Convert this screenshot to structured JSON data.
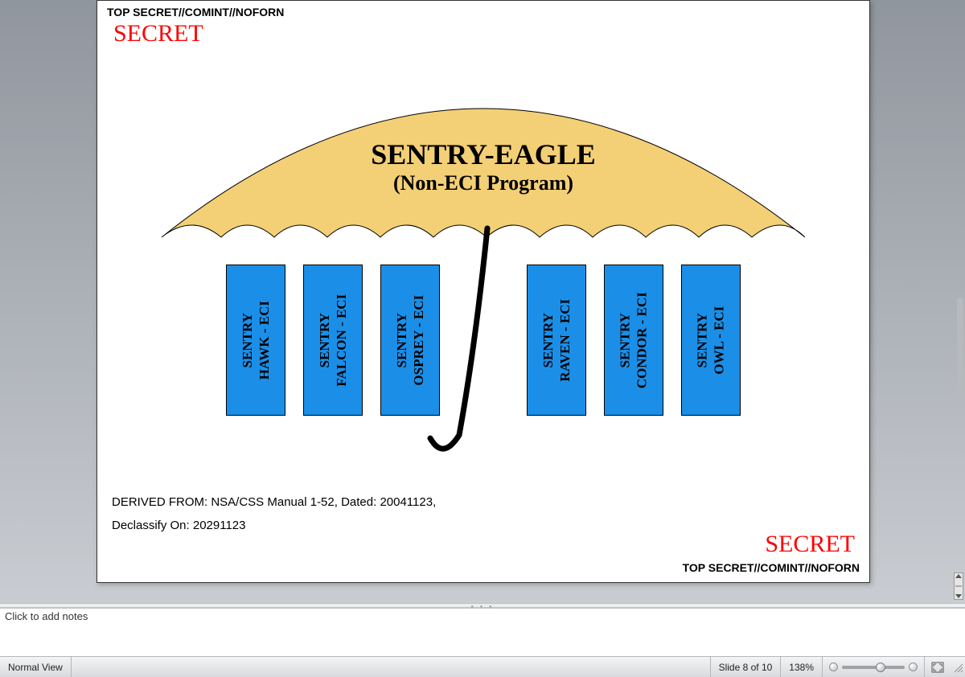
{
  "slide": {
    "classification_top": "TOP SECRET//COMINT//NOFORN",
    "secret_top": "SECRET",
    "umbrella_title": "SENTRY-EAGLE",
    "umbrella_subtitle": "(Non-ECI Program)",
    "programs": [
      {
        "line1": "SENTRY",
        "line2": "HAWK - ECI"
      },
      {
        "line1": "SENTRY",
        "line2": "FALCON - ECI"
      },
      {
        "line1": "SENTRY",
        "line2": "OSPREY - ECI"
      },
      {
        "line1": "SENTRY",
        "line2": "RAVEN - ECI"
      },
      {
        "line1": "SENTRY",
        "line2": "CONDOR - ECI"
      },
      {
        "line1": "SENTRY",
        "line2": "OWL - ECI"
      }
    ],
    "derived_line1": "DERIVED FROM: NSA/CSS Manual 1-52, Dated: 20041123,",
    "derived_line2": "Declassify On: 20291123",
    "secret_bottom": "SECRET",
    "classification_bottom": "TOP SECRET//COMINT//NOFORN"
  },
  "notes": {
    "placeholder": "Click to add notes"
  },
  "statusbar": {
    "view_mode": "Normal View",
    "slide_counter": "Slide 8 of 10",
    "zoom_label": "138%"
  }
}
